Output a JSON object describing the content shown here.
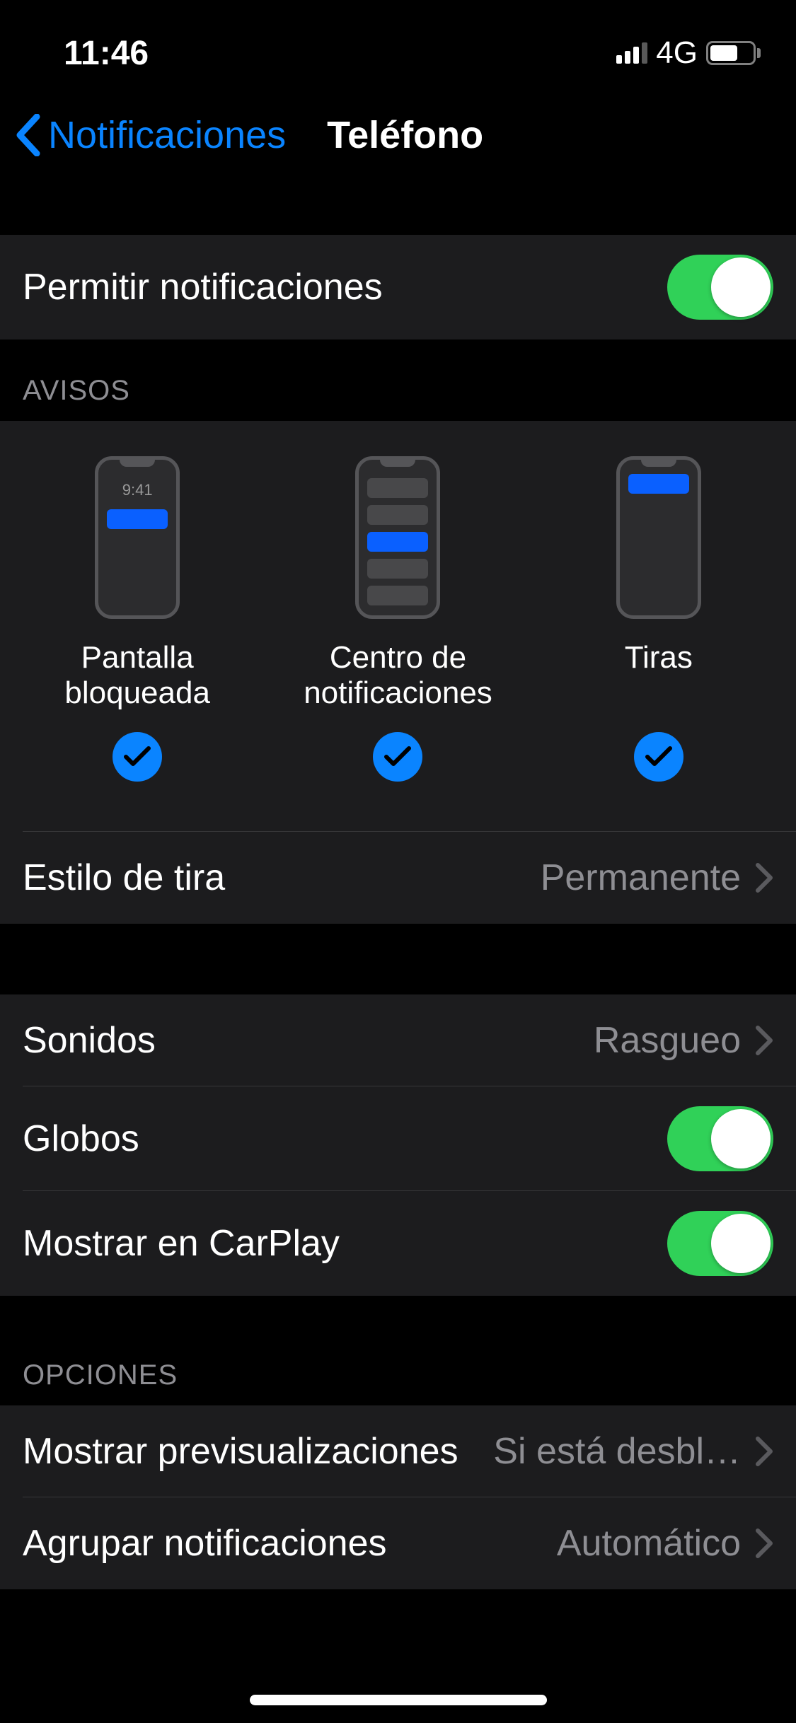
{
  "status": {
    "time": "11:46",
    "network": "4G"
  },
  "nav": {
    "back_label": "Notificaciones",
    "title": "Teléfono"
  },
  "allow": {
    "label": "Permitir notificaciones"
  },
  "alerts": {
    "header": "AVISOS",
    "items": [
      {
        "label": "Pantalla bloqueada"
      },
      {
        "label": "Centro de notificaciones"
      },
      {
        "label": "Tiras"
      }
    ],
    "lock_time": "9:41",
    "banner_style": {
      "label": "Estilo de tira",
      "value": "Permanente"
    }
  },
  "sounds": {
    "label": "Sonidos",
    "value": "Rasgueo"
  },
  "badges": {
    "label": "Globos"
  },
  "carplay": {
    "label": "Mostrar en CarPlay"
  },
  "options": {
    "header": "OPCIONES",
    "previews": {
      "label": "Mostrar previsualizaciones",
      "value": "Si está desbl…"
    },
    "grouping": {
      "label": "Agrupar notificaciones",
      "value": "Automático"
    }
  }
}
